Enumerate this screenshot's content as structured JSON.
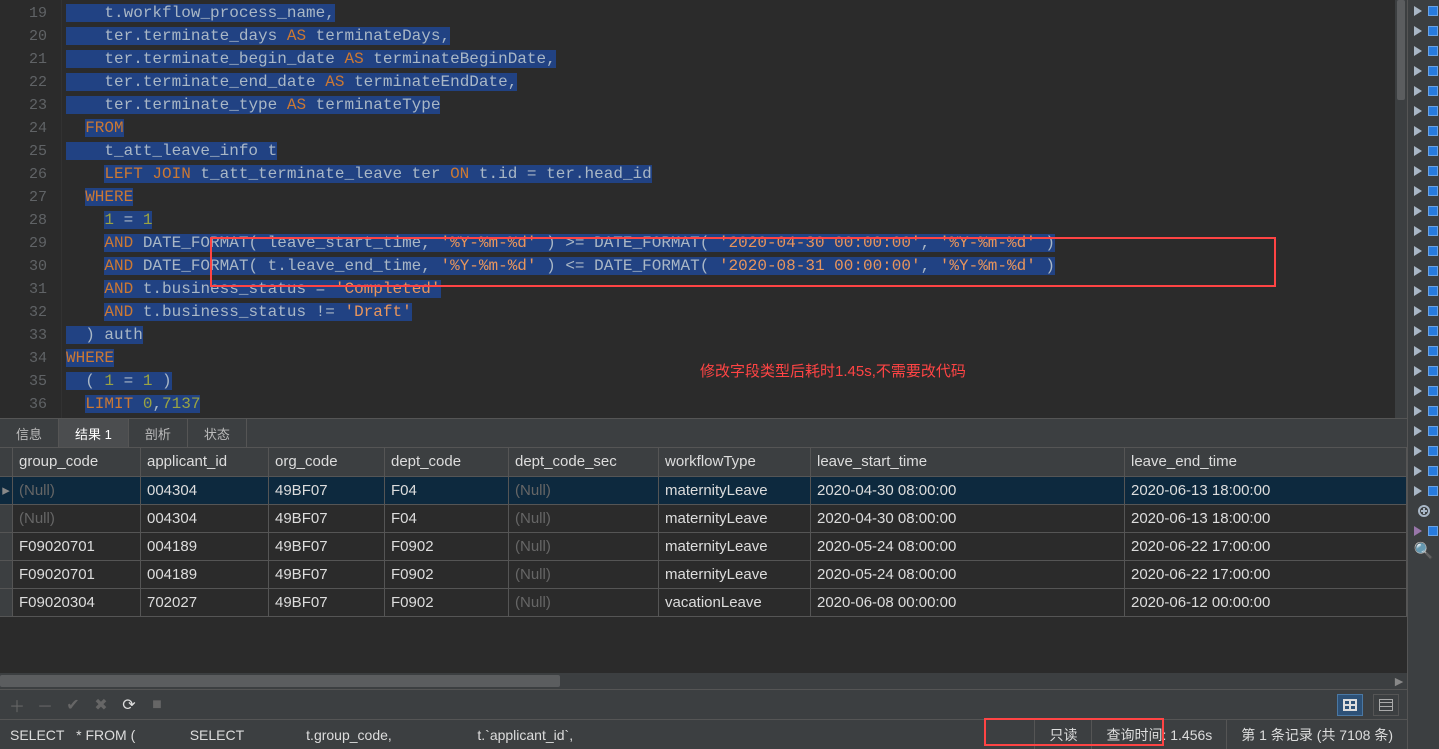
{
  "annotation": "修改字段类型后耗时1.45s,不需要改代码",
  "editor": {
    "lineStart": 19,
    "lines": [
      {
        "tokens": [
          {
            "t": "    t",
            "c": "id",
            "sel": true
          },
          {
            "t": ".",
            "c": "id",
            "sel": true
          },
          {
            "t": "workflow_process_name",
            "c": "id",
            "sel": true
          },
          {
            "t": ",",
            "c": "id",
            "sel": true
          }
        ]
      },
      {
        "tokens": [
          {
            "t": "    ter",
            "c": "id",
            "sel": true
          },
          {
            "t": ".",
            "c": "id",
            "sel": true
          },
          {
            "t": "terminate_days ",
            "c": "id",
            "sel": true
          },
          {
            "t": "AS",
            "c": "kw",
            "sel": true
          },
          {
            "t": " terminateDays",
            "c": "id",
            "sel": true
          },
          {
            "t": ",",
            "c": "id",
            "sel": true
          }
        ]
      },
      {
        "tokens": [
          {
            "t": "    ter",
            "c": "id",
            "sel": true
          },
          {
            "t": ".",
            "c": "id",
            "sel": true
          },
          {
            "t": "terminate_begin_date ",
            "c": "id",
            "sel": true
          },
          {
            "t": "AS",
            "c": "kw",
            "sel": true
          },
          {
            "t": " terminateBeginDate",
            "c": "id",
            "sel": true
          },
          {
            "t": ",",
            "c": "id",
            "sel": true
          }
        ]
      },
      {
        "tokens": [
          {
            "t": "    ter",
            "c": "id",
            "sel": true
          },
          {
            "t": ".",
            "c": "id",
            "sel": true
          },
          {
            "t": "terminate_end_date ",
            "c": "id",
            "sel": true
          },
          {
            "t": "AS",
            "c": "kw",
            "sel": true
          },
          {
            "t": " terminateEndDate",
            "c": "id",
            "sel": true
          },
          {
            "t": ",",
            "c": "id",
            "sel": true
          }
        ]
      },
      {
        "tokens": [
          {
            "t": "    ter",
            "c": "id",
            "sel": true
          },
          {
            "t": ".",
            "c": "id",
            "sel": true
          },
          {
            "t": "terminate_type ",
            "c": "id",
            "sel": true
          },
          {
            "t": "AS",
            "c": "kw",
            "sel": true
          },
          {
            "t": " terminateType",
            "c": "id",
            "sel": true
          }
        ]
      },
      {
        "tokens": [
          {
            "t": "  ",
            "c": "id",
            "sel": false
          },
          {
            "t": "FROM",
            "c": "kw",
            "sel": true
          }
        ]
      },
      {
        "tokens": [
          {
            "t": "    t_att_leave_info t",
            "c": "id",
            "sel": true
          }
        ]
      },
      {
        "tokens": [
          {
            "t": "    ",
            "c": "id",
            "sel": false
          },
          {
            "t": "LEFT",
            "c": "kw",
            "sel": true
          },
          {
            "t": " ",
            "c": "id",
            "sel": true
          },
          {
            "t": "JOIN",
            "c": "kw",
            "sel": true
          },
          {
            "t": " t_att_terminate_leave ter ",
            "c": "id",
            "sel": true
          },
          {
            "t": "ON",
            "c": "kw",
            "sel": true
          },
          {
            "t": " t",
            "c": "id",
            "sel": true
          },
          {
            "t": ".",
            "c": "id",
            "sel": true
          },
          {
            "t": "id ",
            "c": "id",
            "sel": true
          },
          {
            "t": "=",
            "c": "id",
            "sel": true
          },
          {
            "t": " ter",
            "c": "id",
            "sel": true
          },
          {
            "t": ".",
            "c": "id",
            "sel": true
          },
          {
            "t": "head_id",
            "c": "id",
            "sel": true
          }
        ]
      },
      {
        "tokens": [
          {
            "t": "  ",
            "c": "id",
            "sel": false
          },
          {
            "t": "WHERE",
            "c": "kw",
            "sel": true
          }
        ]
      },
      {
        "tokens": [
          {
            "t": "    ",
            "c": "id",
            "sel": false
          },
          {
            "t": "1",
            "c": "num",
            "sel": true
          },
          {
            "t": " ",
            "c": "id",
            "sel": true
          },
          {
            "t": "=",
            "c": "id",
            "sel": true
          },
          {
            "t": " ",
            "c": "id",
            "sel": true
          },
          {
            "t": "1",
            "c": "num",
            "sel": true
          }
        ]
      },
      {
        "tokens": [
          {
            "t": "    ",
            "c": "id",
            "sel": false
          },
          {
            "t": "AND",
            "c": "kw",
            "sel": true
          },
          {
            "t": " DATE_FORMAT",
            "c": "id",
            "sel": true
          },
          {
            "t": "( leave_start_time, ",
            "c": "id",
            "sel": true
          },
          {
            "t": "'%Y-%m-%d'",
            "c": "str",
            "sel": true
          },
          {
            "t": " ) ",
            "c": "id",
            "sel": true
          },
          {
            "t": ">=",
            "c": "id",
            "sel": true
          },
          {
            "t": " DATE_FORMAT",
            "c": "id",
            "sel": true
          },
          {
            "t": "( ",
            "c": "id",
            "sel": true
          },
          {
            "t": "'2020-04-30 00:00:00'",
            "c": "str",
            "sel": true
          },
          {
            "t": ", ",
            "c": "id",
            "sel": true
          },
          {
            "t": "'%Y-%m-%d'",
            "c": "str",
            "sel": true
          },
          {
            "t": " )",
            "c": "id",
            "sel": true
          }
        ]
      },
      {
        "tokens": [
          {
            "t": "    ",
            "c": "id",
            "sel": false
          },
          {
            "t": "AND",
            "c": "kw",
            "sel": true
          },
          {
            "t": " DATE_FORMAT",
            "c": "id",
            "sel": true
          },
          {
            "t": "( t",
            "c": "id",
            "sel": true
          },
          {
            "t": ".",
            "c": "id",
            "sel": true
          },
          {
            "t": "leave_end_time, ",
            "c": "id",
            "sel": true
          },
          {
            "t": "'%Y-%m-%d'",
            "c": "str",
            "sel": true
          },
          {
            "t": " ) ",
            "c": "id",
            "sel": true
          },
          {
            "t": "<=",
            "c": "id",
            "sel": true
          },
          {
            "t": " DATE_FORMAT",
            "c": "id",
            "sel": true
          },
          {
            "t": "( ",
            "c": "id",
            "sel": true
          },
          {
            "t": "'2020-08-31 00:00:00'",
            "c": "str",
            "sel": true
          },
          {
            "t": ", ",
            "c": "id",
            "sel": true
          },
          {
            "t": "'%Y-%m-%d'",
            "c": "str",
            "sel": true
          },
          {
            "t": " )",
            "c": "id",
            "sel": true
          }
        ]
      },
      {
        "tokens": [
          {
            "t": "    ",
            "c": "id",
            "sel": false
          },
          {
            "t": "AND",
            "c": "kw",
            "sel": true
          },
          {
            "t": " t",
            "c": "id",
            "sel": true
          },
          {
            "t": ".",
            "c": "id",
            "sel": true
          },
          {
            "t": "business_status ",
            "c": "id",
            "sel": true
          },
          {
            "t": "=",
            "c": "id",
            "sel": true
          },
          {
            "t": " ",
            "c": "id",
            "sel": true
          },
          {
            "t": "'Completed'",
            "c": "str",
            "sel": true
          }
        ]
      },
      {
        "tokens": [
          {
            "t": "    ",
            "c": "id",
            "sel": false
          },
          {
            "t": "AND",
            "c": "kw",
            "sel": true
          },
          {
            "t": " t",
            "c": "id",
            "sel": true
          },
          {
            "t": ".",
            "c": "id",
            "sel": true
          },
          {
            "t": "business_status ",
            "c": "id",
            "sel": true
          },
          {
            "t": "!=",
            "c": "id",
            "sel": true
          },
          {
            "t": " ",
            "c": "id",
            "sel": true
          },
          {
            "t": "'Draft'",
            "c": "str",
            "sel": true
          }
        ]
      },
      {
        "tokens": [
          {
            "t": "  ) auth",
            "c": "id",
            "sel": true
          }
        ]
      },
      {
        "tokens": [
          {
            "t": "WHERE",
            "c": "kw",
            "sel": true
          }
        ]
      },
      {
        "tokens": [
          {
            "t": "  ( ",
            "c": "id",
            "sel": true
          },
          {
            "t": "1",
            "c": "num",
            "sel": true
          },
          {
            "t": " ",
            "c": "id",
            "sel": true
          },
          {
            "t": "=",
            "c": "id",
            "sel": true
          },
          {
            "t": " ",
            "c": "id",
            "sel": true
          },
          {
            "t": "1",
            "c": "num",
            "sel": true
          },
          {
            "t": " )",
            "c": "id",
            "sel": true
          }
        ]
      },
      {
        "tokens": [
          {
            "t": "  ",
            "c": "id",
            "sel": false
          },
          {
            "t": "LIMIT",
            "c": "kw",
            "sel": true
          },
          {
            "t": " ",
            "c": "id",
            "sel": true
          },
          {
            "t": "0",
            "c": "num",
            "sel": true
          },
          {
            "t": ",",
            "c": "id",
            "sel": true
          },
          {
            "t": "7137",
            "c": "num",
            "sel": true
          }
        ]
      }
    ]
  },
  "tabs": [
    {
      "label": "信息",
      "active": false
    },
    {
      "label": "结果 1",
      "active": true
    },
    {
      "label": "剖析",
      "active": false
    },
    {
      "label": "状态",
      "active": false
    }
  ],
  "grid": {
    "columns": [
      "group_code",
      "applicant_id",
      "org_code",
      "dept_code",
      "dept_code_sec",
      "workflowType",
      "leave_start_time",
      "leave_end_time"
    ],
    "rows": [
      {
        "sel": true,
        "cells": [
          "(Null)",
          "004304",
          "49BF07",
          "F04",
          "(Null)",
          "maternityLeave",
          "2020-04-30 08:00:00",
          "2020-06-13 18:00:00"
        ]
      },
      {
        "cells": [
          "(Null)",
          "004304",
          "49BF07",
          "F04",
          "(Null)",
          "maternityLeave",
          "2020-04-30 08:00:00",
          "2020-06-13 18:00:00"
        ]
      },
      {
        "cells": [
          "F09020701",
          "004189",
          "49BF07",
          "F0902",
          "(Null)",
          "maternityLeave",
          "2020-05-24 08:00:00",
          "2020-06-22 17:00:00"
        ]
      },
      {
        "cells": [
          "F09020701",
          "004189",
          "49BF07",
          "F0902",
          "(Null)",
          "maternityLeave",
          "2020-05-24 08:00:00",
          "2020-06-22 17:00:00"
        ]
      },
      {
        "cells": [
          "F09020304",
          "702027",
          "49BF07",
          "F0902",
          "(Null)",
          "vacationLeave",
          "2020-06-08 00:00:00",
          "2020-06-12 00:00:00"
        ]
      }
    ]
  },
  "status": {
    "sql1": "SELECT",
    "sql2": "* FROM  (",
    "sql3": "SELECT",
    "sql4": "t.group_code,",
    "sql5": "t.`applicant_id`,",
    "readonly": "只读",
    "time": "查询时间: 1.456s",
    "records": "第 1 条记录 (共 7108 条)"
  }
}
